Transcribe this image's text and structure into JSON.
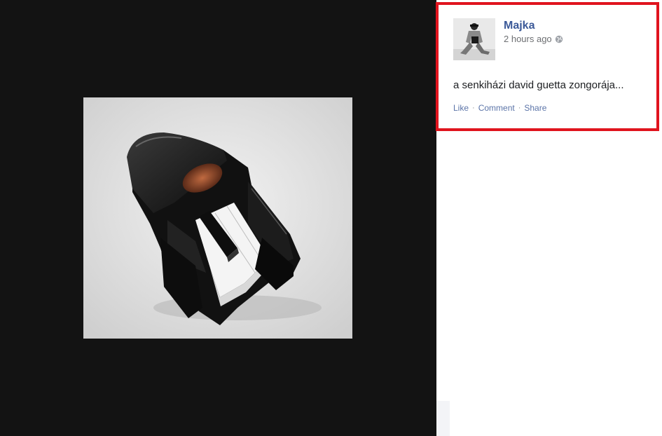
{
  "post": {
    "author": "Majka",
    "timestamp": "2 hours ago",
    "privacy_icon": "globe-icon",
    "text": "a senkiházi david guetta zongorája...",
    "actions": {
      "like": "Like",
      "comment": "Comment",
      "share": "Share",
      "separator": "·"
    }
  },
  "colors": {
    "viewer_background": "#131313",
    "highlight_border": "#e0141e",
    "author_link": "#3b5998",
    "action_link": "#5b74a8",
    "meta_text": "#6d6f72"
  }
}
